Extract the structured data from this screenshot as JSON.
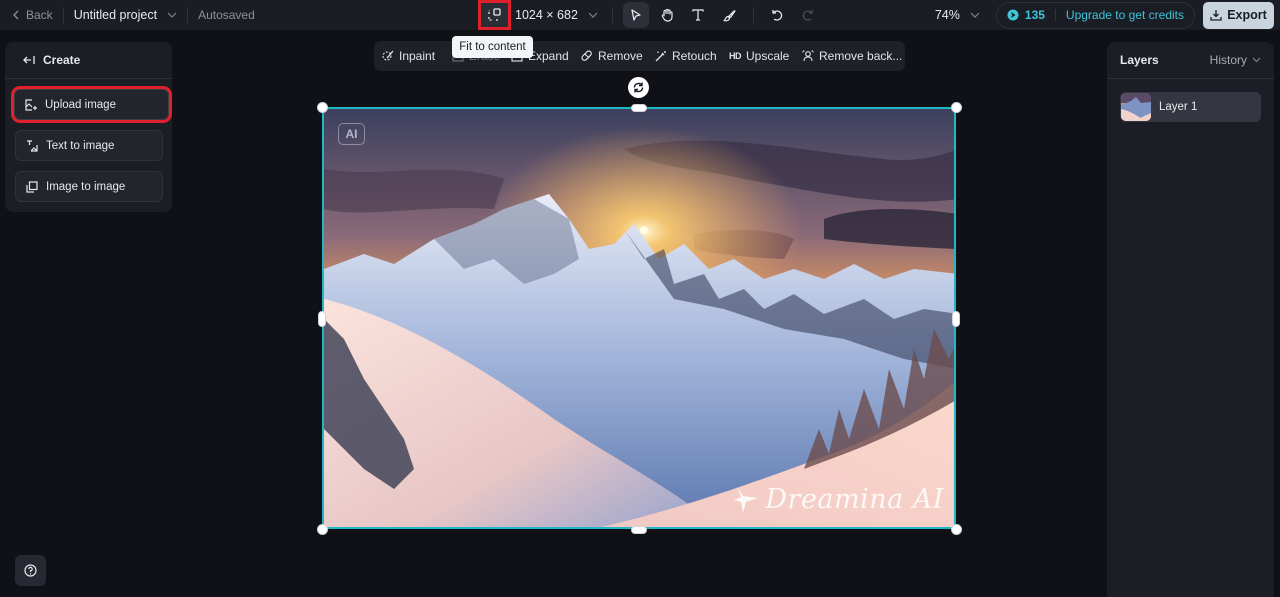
{
  "topbar": {
    "back_label": "Back",
    "project_name": "Untitled project",
    "save_status": "Autosaved",
    "canvas_size": "1024 × 682",
    "zoom": "74%",
    "credits": "135",
    "upgrade_label": "Upgrade to get credits",
    "export_label": "Export",
    "fit_tooltip": "Fit to content"
  },
  "edit_toolbar": {
    "items": [
      {
        "label": "Inpaint",
        "icon": "inpaint-icon"
      },
      {
        "label": "Erase",
        "icon": "erase-icon"
      },
      {
        "label": "Expand",
        "icon": "expand-icon"
      },
      {
        "label": "Remove",
        "icon": "eraser-icon"
      },
      {
        "label": "Retouch",
        "icon": "magic-wand-icon"
      },
      {
        "label": "Upscale",
        "icon": "hd-icon",
        "badge": "HD"
      },
      {
        "label": "Remove back...",
        "icon": "person-cutout-icon"
      }
    ]
  },
  "create_panel": {
    "title": "Create",
    "items": [
      {
        "label": "Upload image",
        "icon": "upload-image-icon"
      },
      {
        "label": "Text to image",
        "icon": "text-to-image-icon"
      },
      {
        "label": "Image to image",
        "icon": "image-to-image-icon"
      }
    ]
  },
  "layers_panel": {
    "title": "Layers",
    "history_label": "History",
    "layers": [
      {
        "name": "Layer 1"
      }
    ]
  },
  "canvas": {
    "ai_badge": "AI",
    "watermark": "Dreamina AI"
  },
  "colors": {
    "accent": "#1fb8c4",
    "credits": "#3fc4d8",
    "highlight": "#e0202a"
  }
}
